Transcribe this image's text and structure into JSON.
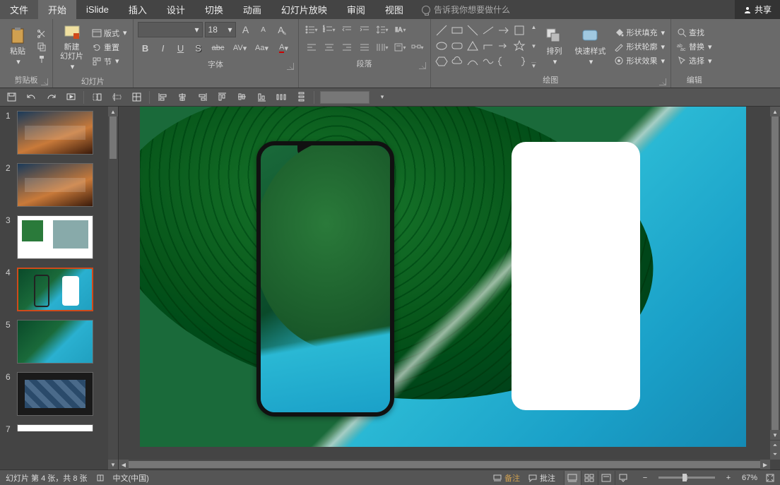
{
  "menu": {
    "file": "文件",
    "home": "开始",
    "islide": "iSlide",
    "insert": "插入",
    "design": "设计",
    "transition": "切换",
    "animation": "动画",
    "slideshow": "幻灯片放映",
    "review": "审阅",
    "view": "视图",
    "tell_me": "告诉我你想要做什么",
    "share": "共享"
  },
  "ribbon": {
    "clipboard": {
      "label": "剪贴板",
      "paste": "粘贴"
    },
    "slides": {
      "label": "幻灯片",
      "new_slide": "新建\n幻灯片",
      "layout": "版式",
      "reset": "重置",
      "section": "节"
    },
    "font": {
      "label": "字体",
      "size": "18",
      "bold": "B",
      "italic": "I",
      "underline": "U",
      "strike": "S",
      "spacing": "AV",
      "case": "Aa",
      "color": "A",
      "grow": "A",
      "shrink": "A",
      "clear": "A"
    },
    "paragraph": {
      "label": "段落"
    },
    "drawing": {
      "label": "绘图",
      "arrange": "排列",
      "quick_styles": "快速样式",
      "shape_fill": "形状填充",
      "shape_outline": "形状轮廓",
      "shape_effects": "形状效果"
    },
    "editing": {
      "label": "编辑",
      "find": "查找",
      "replace": "替换",
      "select": "选择"
    }
  },
  "slides_panel": {
    "numbers": [
      "1",
      "2",
      "3",
      "4",
      "5",
      "6",
      "7"
    ],
    "current_index": 4
  },
  "status": {
    "slide_info": "幻灯片 第 4 张，共 8 张",
    "language": "中文(中国)",
    "notes": "备注",
    "comments": "批注",
    "zoom_pct": "67%"
  }
}
